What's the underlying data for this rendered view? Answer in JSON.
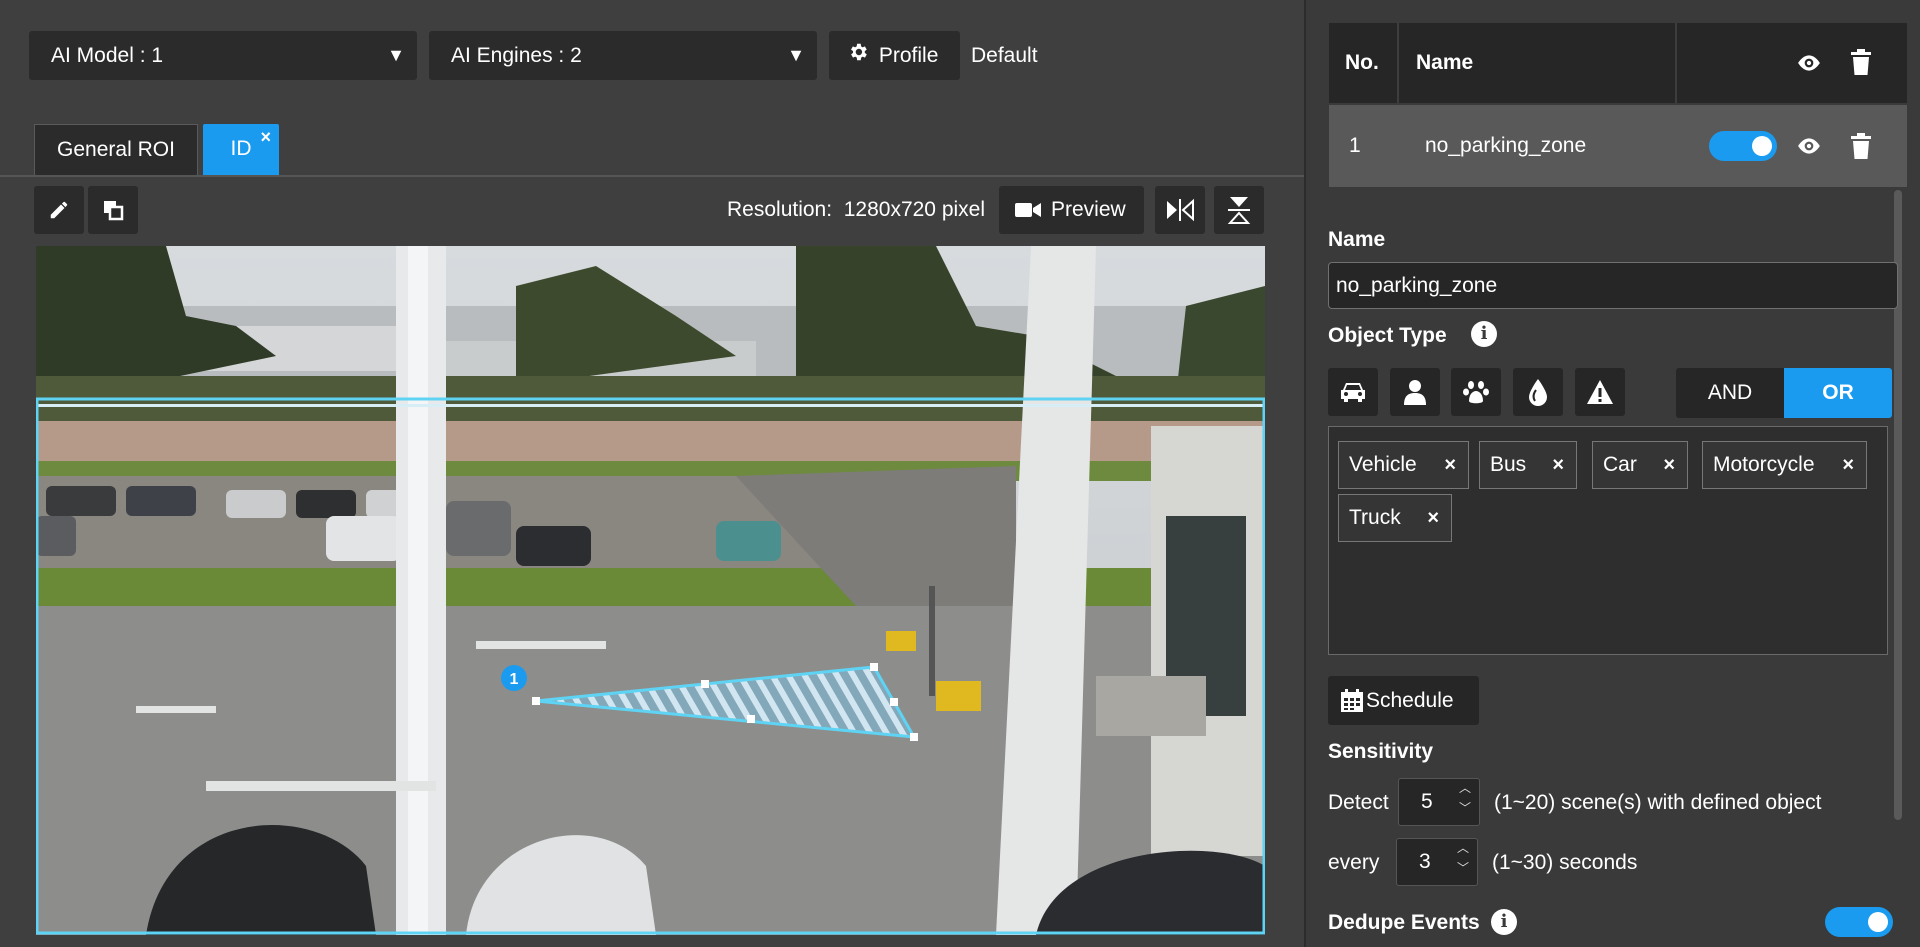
{
  "toolbar": {
    "ai_model": "AI Model : 1",
    "ai_engines": "AI Engines : 2",
    "profile_label": "Profile",
    "profile_value": "Default"
  },
  "tabs": [
    {
      "label": "General ROI"
    },
    {
      "label": "ID"
    }
  ],
  "editor": {
    "resolution_label": "Resolution:",
    "resolution_value": "1280x720 pixel",
    "preview_label": "Preview",
    "roi_marker": "1"
  },
  "roi_table": {
    "headers": {
      "no": "No.",
      "name": "Name"
    },
    "rows": [
      {
        "no": "1",
        "name": "no_parking_zone",
        "enabled": true
      }
    ]
  },
  "form": {
    "name_label": "Name",
    "name_value": "no_parking_zone",
    "object_type_label": "Object Type",
    "object_icons": [
      "vehicle-icon",
      "person-icon",
      "animal-icon",
      "liquid-icon",
      "warning-icon"
    ],
    "logic_and": "AND",
    "logic_or": "OR",
    "logic_selected": "OR",
    "chips": [
      "Vehicle",
      "Bus",
      "Car",
      "Motorcycle",
      "Truck"
    ],
    "schedule_label": "Schedule",
    "sensitivity_label": "Sensitivity",
    "detect_label": "Detect",
    "detect_value": "5",
    "detect_suffix": "(1~20) scene(s) with defined object",
    "every_label": "every",
    "every_value": "3",
    "every_suffix": "(1~30) seconds",
    "dedupe_label": "Dedupe Events",
    "dedupe_enabled": true
  },
  "colors": {
    "accent": "#1a9bef",
    "roi_outline": "#5fd3f3"
  }
}
